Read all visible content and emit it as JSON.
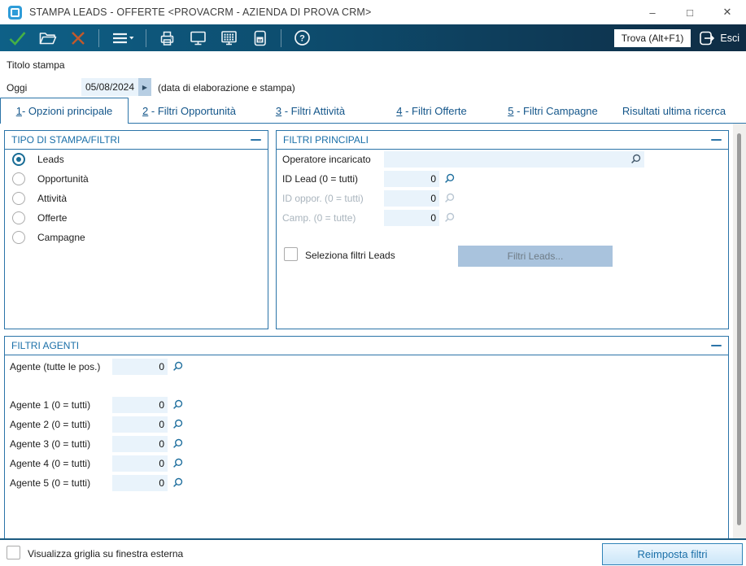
{
  "window": {
    "title": "STAMPA LEADS - OFFERTE <PROVACRM - AZIENDA DI PROVA CRM>",
    "minimize_glyph": "–",
    "maximize_glyph": "□",
    "close_glyph": "✕"
  },
  "toolbar": {
    "icons": [
      "confirm-check-icon",
      "open-folder-icon",
      "cancel-x-icon",
      "menu-icon",
      "print-icon",
      "preview-monitor-icon",
      "grid-monitor-icon",
      "word-export-icon",
      "help-icon"
    ],
    "trova_label": "Trova (Alt+F1)",
    "esci_label": "Esci"
  },
  "header_form": {
    "titolo_label": "Titolo stampa",
    "oggi_label": "Oggi",
    "date_value": "05/08/2024",
    "date_hint": "(data di elaborazione e stampa)"
  },
  "tabs": [
    {
      "num": "1",
      "rest": "- Opzioni principale"
    },
    {
      "num": "2",
      "rest": " - Filtri Opportunità"
    },
    {
      "num": "3",
      "rest": " - Filtri Attività"
    },
    {
      "num": "4",
      "rest": " - Filtri Offerte"
    },
    {
      "num": "5",
      "rest": " - Filtri Campagne"
    },
    {
      "num": "",
      "rest": "Risultati ultima ricerca"
    }
  ],
  "tipo_panel": {
    "title": "TIPO DI STAMPA/FILTRI",
    "options": [
      "Leads",
      "Opportunità",
      "Attività",
      "Offerte",
      "Campagne"
    ],
    "selected": "Leads"
  },
  "filtri_principali": {
    "title": "FILTRI PRINCIPALI",
    "operatore_label": "Operatore incaricato",
    "operatore_value": "",
    "id_lead_label": "ID Lead (0 = tutti)",
    "id_lead_value": "0",
    "id_oppor_label": "ID oppor. (0 = tutti)",
    "id_oppor_value": "0",
    "camp_label": "Camp. (0 = tutte)",
    "camp_value": "0",
    "seleziona_label": "Seleziona filtri Leads",
    "filtri_leads_button": "Filtri Leads..."
  },
  "filtri_agenti": {
    "title": "FILTRI AGENTI",
    "rows": [
      {
        "label": "Agente (tutte le pos.)",
        "value": "0"
      },
      {
        "label": "Agente 1 (0 = tutti)",
        "value": "0"
      },
      {
        "label": "Agente 2 (0 = tutti)",
        "value": "0"
      },
      {
        "label": "Agente 3 (0 = tutti)",
        "value": "0"
      },
      {
        "label": "Agente 4 (0 = tutti)",
        "value": "0"
      },
      {
        "label": "Agente 5 (0 = tutti)",
        "value": "0"
      }
    ]
  },
  "footer": {
    "griglia_label": "Visualizza griglia su finestra esterna",
    "reimposta_button": "Reimposta filtri"
  },
  "colors": {
    "accent_blue": "#2B74A8",
    "panel_title_blue": "#1A6FA8",
    "toolbar_left": "#0E6087",
    "toolbar_right": "#0F2C44",
    "field_bg": "#E9F3FB",
    "disabled_text": "#A9B4BD",
    "check_green": "#45B045",
    "x_orange": "#C2592B"
  }
}
